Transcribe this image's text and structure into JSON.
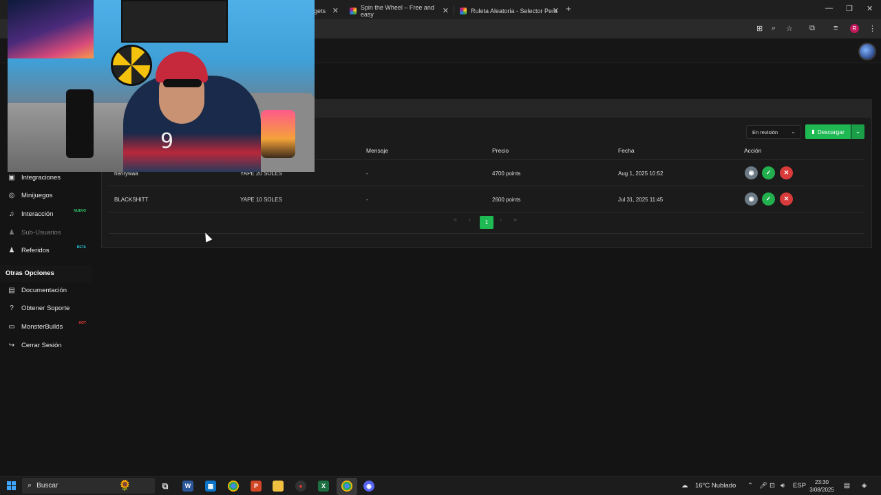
{
  "browser": {
    "tabs": [
      {
        "title": "gets",
        "active": false
      },
      {
        "title": "Spin the Wheel – Free and easy",
        "active": false
      },
      {
        "title": "Ruleta Aleatoria - Selector Pers",
        "active": true
      }
    ],
    "profile_initial": "R"
  },
  "sidebar": {
    "items": [
      {
        "label": "Integraciones",
        "icon": "plug-icon",
        "badge": ""
      },
      {
        "label": "Minijuegos",
        "icon": "gamepad-icon",
        "badge": ""
      },
      {
        "label": "Interacción",
        "icon": "music-icon",
        "badge": "NUEVO"
      },
      {
        "label": "Sub-Usuarios",
        "icon": "users-icon",
        "badge": ""
      },
      {
        "label": "Referidos",
        "icon": "users-icon",
        "badge": "BETA"
      }
    ],
    "section_title": "Otras Opciones",
    "other_items": [
      {
        "label": "Documentación",
        "icon": "book-icon",
        "badge": ""
      },
      {
        "label": "Obtener Soporte",
        "icon": "help-icon",
        "badge": ""
      },
      {
        "label": "MonsterBuilds",
        "icon": "laptop-icon",
        "badge": "HOT"
      },
      {
        "label": "Cerrar Sesión",
        "icon": "sign-out-icon",
        "badge": ""
      }
    ],
    "badge_colors": {
      "NUEVO": "#2ecc71",
      "BETA": "#26c6da",
      "HOT": "#e53935"
    }
  },
  "toolbar": {
    "filter_value": "En revisión",
    "download_label": "Descargar"
  },
  "table": {
    "headers": [
      "Mensaje",
      "Precio",
      "Fecha",
      "Acción"
    ],
    "rows": [
      {
        "user": "henrywaa",
        "item": "YAPE 20 SOLES",
        "message": "-",
        "price": "4700 points",
        "date": "Aug 1, 2025 10:52"
      },
      {
        "user": "BLACKSHITT",
        "item": "YAPE 10 SOLES",
        "message": "-",
        "price": "2600 points",
        "date": "Jul 31, 2025 11:45"
      }
    ]
  },
  "pagination": {
    "first": "«",
    "prev": "‹",
    "current": "1",
    "next": "›",
    "last": "»"
  },
  "taskbar": {
    "search_placeholder": "Buscar",
    "weather": "16°C  Nublado",
    "language": "ESP",
    "time": "23:30",
    "date": "3/08/2025"
  },
  "colors": {
    "accent": "#1fb954",
    "danger": "#d93b3b",
    "view": "#6c7a86"
  },
  "webcam": {
    "shirt_number": "9"
  }
}
